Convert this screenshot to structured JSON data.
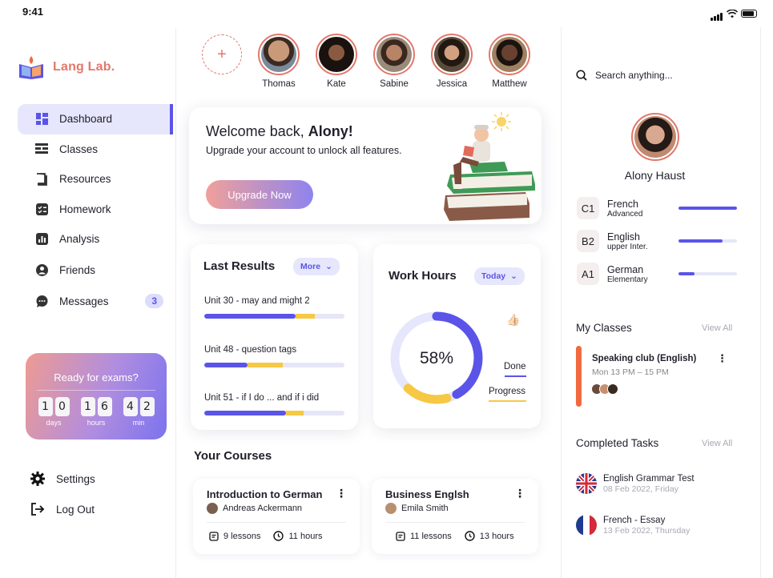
{
  "status_bar": {
    "time": "9:41"
  },
  "brand": {
    "name": "Lang Lab."
  },
  "nav": [
    {
      "label": "Dashboard",
      "icon": "dashboard-icon",
      "active": true
    },
    {
      "label": "Classes",
      "icon": "classes-icon"
    },
    {
      "label": "Resources",
      "icon": "book-icon"
    },
    {
      "label": "Homework",
      "icon": "checklist-icon"
    },
    {
      "label": "Analysis",
      "icon": "chart-icon"
    },
    {
      "label": "Friends",
      "icon": "user-icon"
    },
    {
      "label": "Messages",
      "icon": "chat-icon",
      "badge": "3"
    }
  ],
  "exam": {
    "title": "Ready for exams?",
    "days": [
      "1",
      "0"
    ],
    "hours": [
      "1",
      "6"
    ],
    "mins": [
      "4",
      "2"
    ],
    "days_label": "days",
    "hours_label": "hours",
    "min_label": "min"
  },
  "footer_nav": {
    "settings": "Settings",
    "logout": "Log Out"
  },
  "friends": {
    "add_label": "+",
    "list": [
      {
        "name": "Thomas"
      },
      {
        "name": "Kate"
      },
      {
        "name": "Sabine"
      },
      {
        "name": "Jessica"
      },
      {
        "name": "Matthew"
      }
    ]
  },
  "welcome": {
    "greeting": "Welcome back, ",
    "user": "Alony!",
    "subtitle": "Upgrade your account to unlock all features.",
    "button": "Upgrade Now"
  },
  "last_results": {
    "title": "Last Results",
    "pill": "More",
    "items": [
      {
        "label": "Unit 30  -  may and might 2",
        "primary": 0.65,
        "secondary": 0.14
      },
      {
        "label": "Unit 48  - question tags",
        "primary": 0.31,
        "secondary": 0.25
      },
      {
        "label": "Unit 51  - if I do ... and if i did",
        "primary": 0.58,
        "secondary": 0.13
      }
    ]
  },
  "work_hours": {
    "title": "Work Hours",
    "pill": "Today",
    "percent": "58%",
    "done_label": "Done",
    "progress_label": "Progress",
    "done_fraction": 0.42,
    "progress_fraction": 0.16,
    "colors": {
      "done": "#5b54e8",
      "progress": "#f7c844",
      "track": "#e6e6fc"
    }
  },
  "courses": {
    "title": "Your Courses",
    "items": [
      {
        "title": "Introduction to German",
        "author": "Andreas Ackermann",
        "lessons": "9 lessons",
        "hours": "11 hours"
      },
      {
        "title": "Business Englsh",
        "author": "Emila Smith",
        "lessons": "11 lessons",
        "hours": "13 hours"
      }
    ]
  },
  "right": {
    "search_placeholder": "Search anything...",
    "profile_name": "Alony Haust",
    "languages": [
      {
        "code": "C1",
        "name": "French",
        "level": "Advanced",
        "progress": 1.0
      },
      {
        "code": "B2",
        "name": "English",
        "level": "upper Inter.",
        "progress": 0.75
      },
      {
        "code": "A1",
        "name": "German",
        "level": "Elementary",
        "progress": 0.27
      }
    ],
    "my_classes": {
      "title": "My Classes",
      "view_all": "View All",
      "item": {
        "title": "Speaking club (English)",
        "time": "Mon 13 PM – 15 PM"
      }
    },
    "completed": {
      "title": "Completed Tasks",
      "view_all": "View All",
      "items": [
        {
          "title": "English Grammar Test",
          "date": "08 Feb 2022, Friday",
          "flag": "uk-flag-icon"
        },
        {
          "title": "French - Essay",
          "date": "13 Feb 2022, Thursday",
          "flag": "france-flag-icon"
        }
      ]
    }
  },
  "colors": {
    "accent": "#5b54e8",
    "brand": "#e2786b",
    "yellow": "#f7c844",
    "orange": "#f06a3f"
  }
}
